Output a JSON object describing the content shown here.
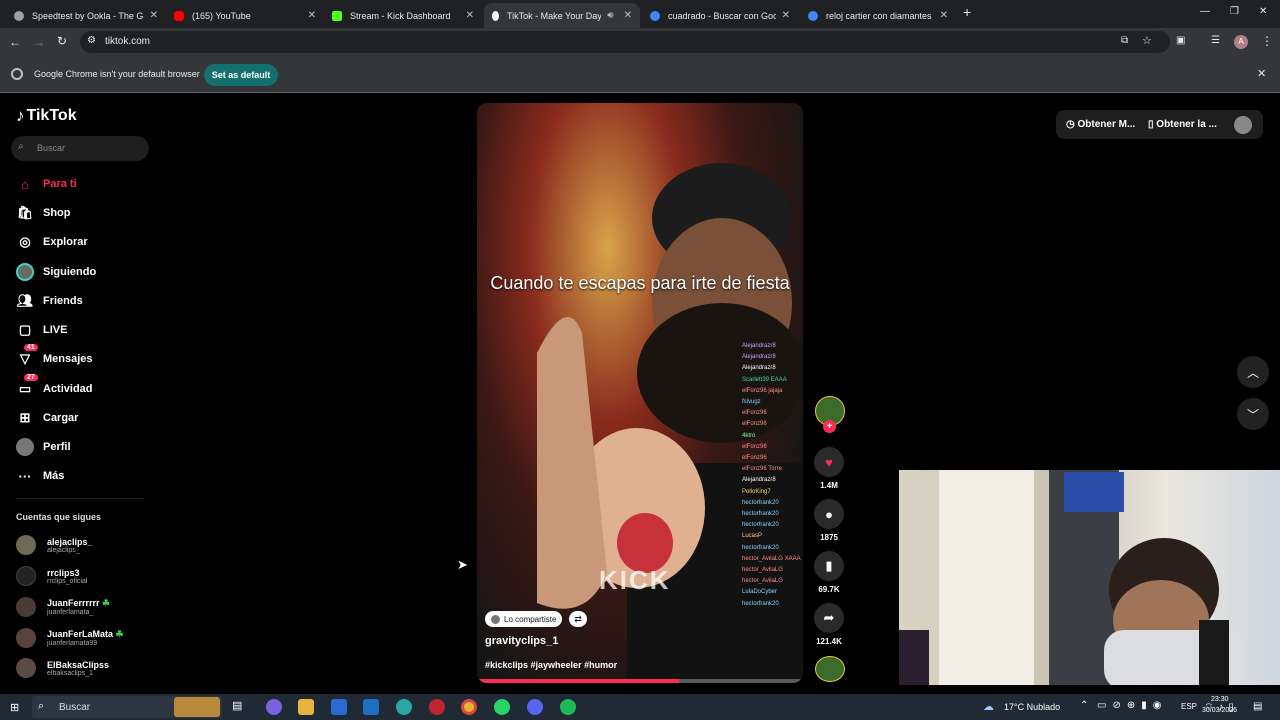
{
  "browser": {
    "tabs": [
      {
        "title": "Speedtest by Ookla - The Globa",
        "color": "#9aa0a6"
      },
      {
        "title": "(165) YouTube",
        "color": "#ff0000"
      },
      {
        "title": "Stream - Kick Dashboard",
        "color": "#53fc18"
      },
      {
        "title": "TikTok - Make Your Day",
        "color": "#ffffff"
      },
      {
        "title": "cuadrado - Buscar con Google",
        "color": "#4285f4"
      },
      {
        "title": "reloj cartier con diamantes de c",
        "color": "#4285f4"
      }
    ],
    "url": "tiktok.com",
    "infobar_text": "Google Chrome isn't your default browser",
    "set_default_label": "Set as default"
  },
  "tiktok": {
    "logo": "TikTok",
    "search_placeholder": "Buscar",
    "nav": [
      {
        "label": "Para ti",
        "icon": "home-icon",
        "active": true
      },
      {
        "label": "Shop",
        "icon": "shop-icon"
      },
      {
        "label": "Explorar",
        "icon": "compass-icon"
      },
      {
        "label": "Siguiendo",
        "icon": "following-avatar-icon"
      },
      {
        "label": "Friends",
        "icon": "friends-icon"
      },
      {
        "label": "LIVE",
        "icon": "live-icon"
      },
      {
        "label": "Mensajes",
        "icon": "messages-icon",
        "badge": "41"
      },
      {
        "label": "Actividad",
        "icon": "activity-icon",
        "badge": "27"
      },
      {
        "label": "Cargar",
        "icon": "upload-icon"
      },
      {
        "label": "Perfil",
        "icon": "profile-icon"
      },
      {
        "label": "Más",
        "icon": "more-icon"
      }
    ],
    "following_title": "Cuentas que sigues",
    "following": [
      {
        "name": "alejaclips_",
        "handle": "alejaclips_",
        "badge": ""
      },
      {
        "name": "rrclips3",
        "handle": "rrclips_oficial",
        "badge": ""
      },
      {
        "name": "JuanFerrrrrr",
        "handle": "juanferlamata_",
        "badge": "☘"
      },
      {
        "name": "JuanFerLaMata",
        "handle": "juanferlamata99",
        "badge": "☘"
      },
      {
        "name": "ElBaksaClipss",
        "handle": "elbaksaclips_1",
        "badge": ""
      }
    ],
    "video": {
      "caption": "Cuando te escapas para irte de fiesta",
      "watermark": "KICK",
      "shared_label": "Lo compartiste",
      "author": "gravityclips_1",
      "hashtags": "#kickclips #jaywheeler #humor",
      "progress": 0.62,
      "chat_names": [
        "Alejandrazr8",
        "Alejandrazr8",
        "Alejandrazr8",
        "Scarlett39",
        "elFonz96",
        "fslvugz",
        "elFonz96",
        "elFonz96",
        "4ktro",
        "elFonz96",
        "elFonz96",
        "elFonz96",
        "Alejandrazr8",
        "PolloKing7",
        "hectorfrank20",
        "hectorfrank20",
        "hectorfrank20",
        "LucasP",
        "hectorfrank20",
        "hector_AvilaLG",
        "hector_AvilaLG",
        "hector_AvilaLG",
        "LulaDoCyber",
        "hectorfrank20"
      ],
      "chat_msgs": {
        "3": "EAAA",
        "4": "jajaja",
        "11": "Torre",
        "19": "XAAA"
      }
    },
    "actions": {
      "likes": "1.4M",
      "comments": "1875",
      "saves": "69.7K",
      "shares": "121.4K"
    },
    "top_right": {
      "get_coins": "Obtener M...",
      "get_app": "Obtener la ..."
    }
  },
  "taskbar": {
    "search_placeholder": "Buscar",
    "weather": "17°C  Nublado",
    "lang": "ESP",
    "time": "23:30",
    "date": "30/03/2026"
  }
}
